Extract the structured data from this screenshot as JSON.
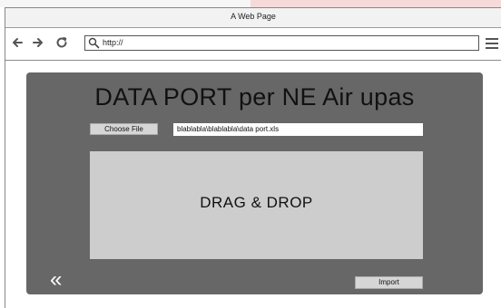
{
  "browser": {
    "window_title": "A Web Page",
    "url": "http://",
    "nav": {
      "back_icon": "back-arrow-icon",
      "forward_icon": "forward-arrow-icon",
      "reload_icon": "reload-icon",
      "menu_icon": "hamburger-menu-icon"
    }
  },
  "page": {
    "title": "DATA PORT per NE Air upas",
    "choose_file_label": "Choose File",
    "file_path_value": "blablabla\\blablabla\\data port.xls",
    "drop_zone_label": "DRAG & DROP",
    "back_label": "«",
    "import_label": "Import"
  },
  "colors": {
    "panel_bg": "#676767",
    "drop_zone_bg": "#cdcdcd",
    "button_bg": "#d6d6d6"
  }
}
